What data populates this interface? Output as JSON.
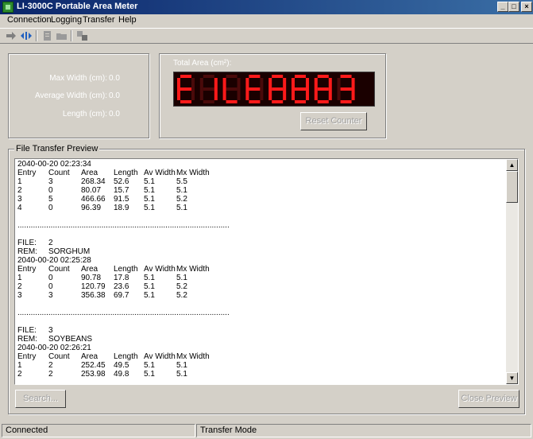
{
  "window": {
    "title": "LI-3000C Portable Area Meter",
    "controls": [
      "_",
      "□",
      "×"
    ]
  },
  "menu": [
    "Connection",
    "Logging",
    "Transfer",
    "Help"
  ],
  "toolbar": {
    "icons": [
      "arrow-right-icon",
      "connect-arrows-icon",
      "document-icon",
      "folder-open-icon",
      "transfer-icon"
    ]
  },
  "measurements": {
    "max_width_label": "Max Width (cm):",
    "max_width_value": "0.0",
    "avg_width_label": "Average Width (cm):",
    "avg_width_value": "0.0",
    "length_label": "Length (cm):",
    "length_value": "0.0"
  },
  "total_area": {
    "label": "Total Area (cm²):",
    "display_text": "E1LE8883",
    "display_color": "#ff1a1a",
    "reset_label": "Reset Counter"
  },
  "preview": {
    "group_title": "File Transfer Preview",
    "separator": "................................................................................................",
    "header": [
      "Entry",
      "Count",
      "Area",
      "Length",
      "Av Width",
      "Mx Width"
    ],
    "files": [
      {
        "file_label": "",
        "file": "",
        "rem_label": "",
        "rem": "",
        "timestamp": "2040-00-20 02:23:34",
        "rows": [
          [
            "1",
            "3",
            "268.34",
            "52.6",
            "5.1",
            "5.5"
          ],
          [
            "2",
            "0",
            "80.07",
            "15.7",
            "5.1",
            "5.1"
          ],
          [
            "3",
            "5",
            "466.66",
            "91.5",
            "5.1",
            "5.2"
          ],
          [
            "4",
            "0",
            "96.39",
            "18.9",
            "5.1",
            "5.1"
          ]
        ]
      },
      {
        "file_label": "FILE:",
        "file": "2",
        "rem_label": "REM:",
        "rem": "SORGHUM",
        "timestamp": "2040-00-20 02:25:28",
        "rows": [
          [
            "1",
            "0",
            "90.78",
            "17.8",
            "5.1",
            "5.1"
          ],
          [
            "2",
            "0",
            "120.79",
            "23.6",
            "5.1",
            "5.2"
          ],
          [
            "3",
            "3",
            "356.38",
            "69.7",
            "5.1",
            "5.2"
          ]
        ]
      },
      {
        "file_label": "FILE:",
        "file": "3",
        "rem_label": "REM:",
        "rem": "SOYBEANS",
        "timestamp": "2040-00-20 02:26:21",
        "rows": [
          [
            "1",
            "2",
            "252.45",
            "49.5",
            "5.1",
            "5.1"
          ],
          [
            "2",
            "2",
            "253.98",
            "49.8",
            "5.1",
            "5.1"
          ]
        ]
      }
    ]
  },
  "buttons": {
    "search_label": "Search...",
    "close_preview_label": "Close Preview"
  },
  "status": {
    "connection": "Connected",
    "mode": "Transfer Mode"
  }
}
